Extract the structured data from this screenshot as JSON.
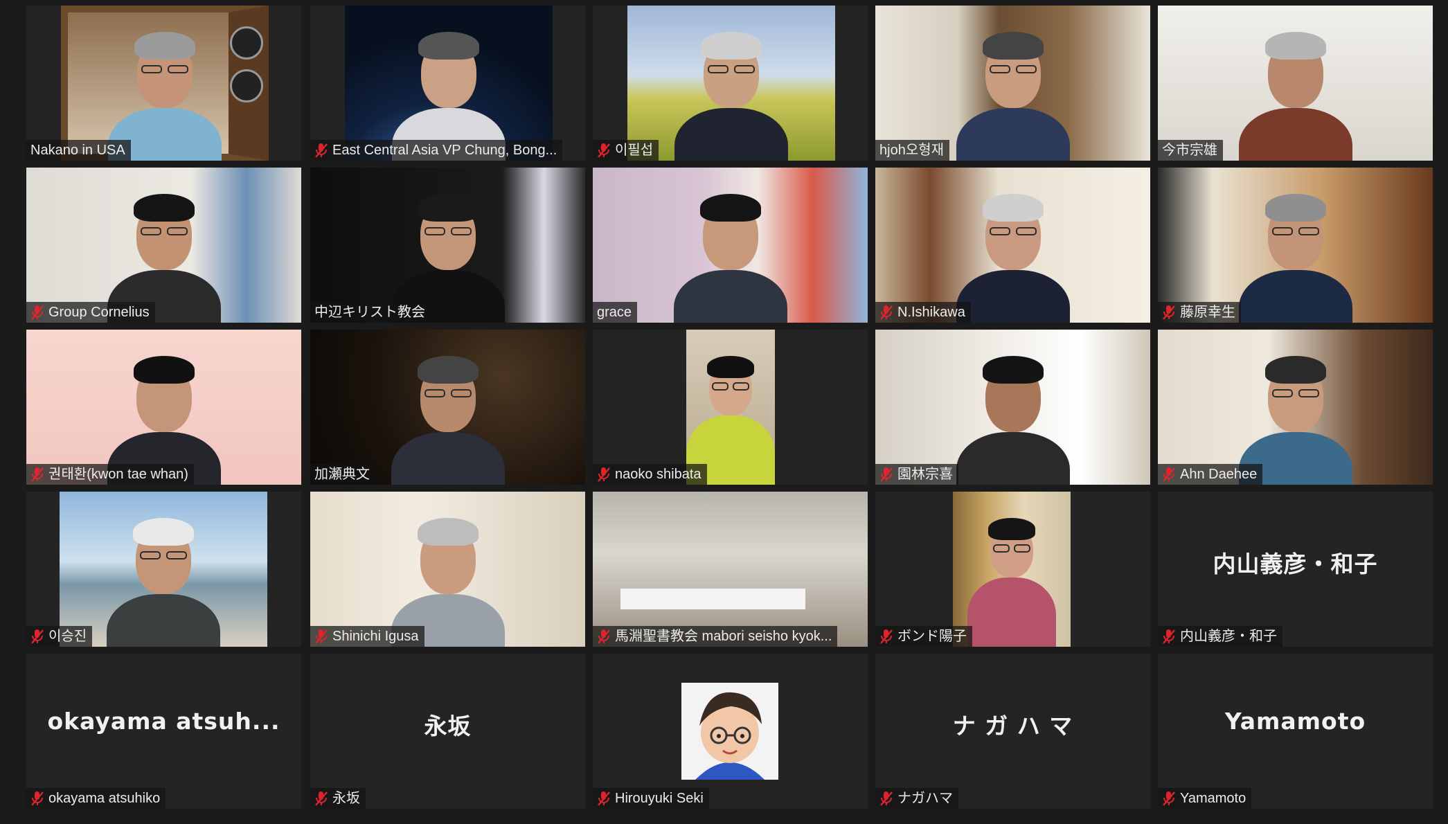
{
  "app": "Zoom meeting gallery view",
  "colors": {
    "background": "#1b1b1b",
    "tile": "#242424",
    "active_speaker": "#c8e34a",
    "muted_icon": "#e0242c",
    "name_text": "#ececec"
  },
  "participants": [
    {
      "name": "Nakano in USA",
      "muted": false,
      "video": true
    },
    {
      "name": "East Central Asia VP Chung, Bong...",
      "muted": true,
      "video": true
    },
    {
      "name": "이필섭",
      "muted": true,
      "video": true
    },
    {
      "name": "hjoh오형재",
      "muted": false,
      "video": true
    },
    {
      "name": "今市宗雄",
      "muted": false,
      "video": true
    },
    {
      "name": "Group Cornelius",
      "muted": true,
      "video": true
    },
    {
      "name": "中辺キリスト教会",
      "muted": false,
      "video": true
    },
    {
      "name": "grace",
      "muted": false,
      "video": true,
      "active": true
    },
    {
      "name": "N.Ishikawa",
      "muted": true,
      "video": true
    },
    {
      "name": "藤原幸生",
      "muted": true,
      "video": true
    },
    {
      "name": "권태환(kwon tae whan)",
      "muted": true,
      "video": true
    },
    {
      "name": "加瀬典文",
      "muted": false,
      "video": true
    },
    {
      "name": "naoko  shibata",
      "muted": true,
      "video": true
    },
    {
      "name": "園林宗喜",
      "muted": true,
      "video": true
    },
    {
      "name": "Ahn Daehee",
      "muted": true,
      "video": true
    },
    {
      "name": "이승진",
      "muted": true,
      "video": true
    },
    {
      "name": "Shinichi Igusa",
      "muted": true,
      "video": true
    },
    {
      "name": "馬淵聖書教会 mabori seisho  kyok...",
      "muted": true,
      "video": true
    },
    {
      "name": "ボンド陽子",
      "muted": true,
      "video": true
    },
    {
      "name": "内山義彦・和子",
      "muted": true,
      "video": false,
      "display_text": "内山義彦・和子"
    },
    {
      "name": "okayama  atsuhiko",
      "muted": true,
      "video": false,
      "display_text": "okayama   atsuh..."
    },
    {
      "name": "永坂",
      "muted": true,
      "video": false,
      "display_text": "永坂"
    },
    {
      "name": "Hirouyuki Seki",
      "muted": true,
      "video": false,
      "avatar": "cartoon-avatar"
    },
    {
      "name": "ナガハマ",
      "muted": true,
      "video": false,
      "display_text": "ナ ガ ハ マ"
    },
    {
      "name": "Yamamoto",
      "muted": true,
      "video": false,
      "display_text": "Yamamoto"
    }
  ]
}
